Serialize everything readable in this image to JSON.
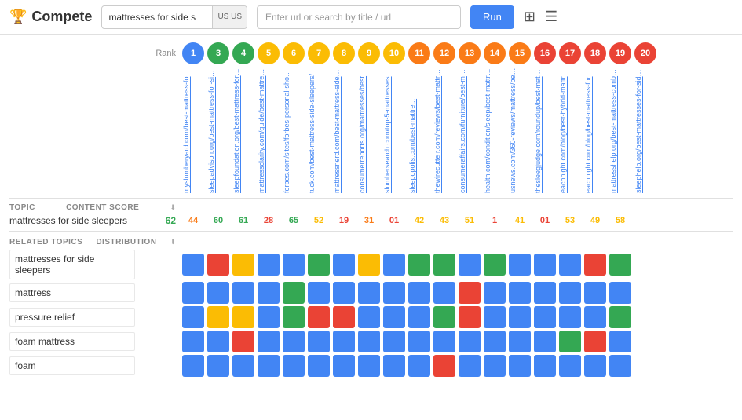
{
  "app": {
    "title": "Compete",
    "logo_icon": "trophy"
  },
  "header": {
    "keyword": "mattresses for side s",
    "locale": "US US",
    "url_placeholder": "Enter url or search by title / url",
    "run_label": "Run"
  },
  "ranks": [
    1,
    3,
    4,
    5,
    6,
    7,
    8,
    9,
    10,
    11,
    12,
    13,
    14,
    15,
    16,
    17,
    18,
    19,
    20
  ],
  "rank_colors": [
    "#4285f4",
    "#34a853",
    "#34a853",
    "#fbbc04",
    "#fbbc04",
    "#fbbc04",
    "#fbbc04",
    "#fbbc04",
    "#fbbc04",
    "#fa7b17",
    "#fa7b17",
    "#fa7b17",
    "#fa7b17",
    "#fa7b17",
    "#ea4335",
    "#ea4335",
    "#ea4335",
    "#ea4335",
    "#ea4335"
  ],
  "urls": [
    "myslumberyard.com/best-mattress-for-side-...",
    "sleepadviso r.org/best-mattress-for-side-sl...",
    "sleepfoundation.org/best-mattress-for-side-...",
    "mattressclarity.com/guide/best-mattress-f...",
    "forbes.com/sites/forbes-personal-shopper/...",
    "tuck.com/best-mattress-side-sleepers/",
    "mattressnerd.com/best-mattress-side-slee...",
    "consumerreports.org/mattresses/best-matt...",
    "slumbersearch.com/top-5-mattresses-for-s...",
    "sleepopolis.com/best-mattre...",
    "thewirecutte r.com/reviews/best-mattresse...",
    "consumeraffairs.com/furniture/best-mattre...",
    "health.com/condition/sleep/best-mattress-...",
    "usnews.com/360-reviews/mattress/best-m...",
    "thesleegjudge.com/roundup/best-mattress-...",
    "eachnight.com/blog/best-hybrid-mattress-f...",
    "eachnight.com/blog/best-mattress-for-side...",
    "mattresshelp.org/best-mattress-combinati...",
    "sleephelp.org/best-mattresses-for-side-sle..."
  ],
  "topic": {
    "topic_label": "TOPIC",
    "score_label": "CONTENT SCORE",
    "name": "mattresses for side sleepers",
    "own_score": "62",
    "own_score_color": "score-green",
    "scores": [
      "44",
      "60",
      "61",
      "28",
      "65",
      "52",
      "19",
      "31",
      "01",
      "42",
      "43",
      "51",
      "1",
      "41",
      "01",
      "53",
      "49",
      "58"
    ],
    "score_colors": [
      "score-orange",
      "score-green",
      "score-green",
      "score-red",
      "score-green",
      "score-yellow",
      "score-red",
      "score-orange",
      "score-red",
      "score-yellow",
      "score-yellow",
      "score-yellow",
      "score-red",
      "score-yellow",
      "score-red",
      "score-yellow",
      "score-yellow",
      "score-yellow"
    ]
  },
  "related_topics": {
    "topic_label": "RELATED TOPICS",
    "dist_label": "DISTRIBUTION",
    "topics": [
      {
        "name": "mattresses for side sleepers",
        "cells": [
          "blue",
          "red",
          "yellow",
          "blue",
          "blue",
          "green",
          "blue",
          "yellow",
          "blue",
          "green",
          "green",
          "blue",
          "green",
          "blue",
          "blue",
          "blue",
          "red",
          "green"
        ]
      },
      {
        "name": "mattress",
        "cells": [
          "blue",
          "blue",
          "blue",
          "blue",
          "green",
          "blue",
          "blue",
          "blue",
          "blue",
          "blue",
          "blue",
          "red",
          "blue",
          "blue",
          "blue",
          "blue",
          "blue",
          "blue"
        ]
      },
      {
        "name": "pressure relief",
        "cells": [
          "blue",
          "yellow",
          "yellow",
          "blue",
          "green",
          "red",
          "red",
          "blue",
          "blue",
          "blue",
          "green",
          "red",
          "blue",
          "blue",
          "blue",
          "blue",
          "blue",
          "green"
        ]
      },
      {
        "name": "foam mattress",
        "cells": [
          "blue",
          "blue",
          "red",
          "blue",
          "blue",
          "blue",
          "blue",
          "blue",
          "blue",
          "blue",
          "blue",
          "blue",
          "blue",
          "blue",
          "blue",
          "green",
          "red",
          "blue"
        ]
      },
      {
        "name": "foam",
        "cells": [
          "blue",
          "blue",
          "blue",
          "blue",
          "blue",
          "blue",
          "blue",
          "blue",
          "blue",
          "blue",
          "red",
          "blue",
          "blue",
          "blue",
          "blue",
          "blue",
          "blue",
          "blue"
        ]
      }
    ]
  }
}
